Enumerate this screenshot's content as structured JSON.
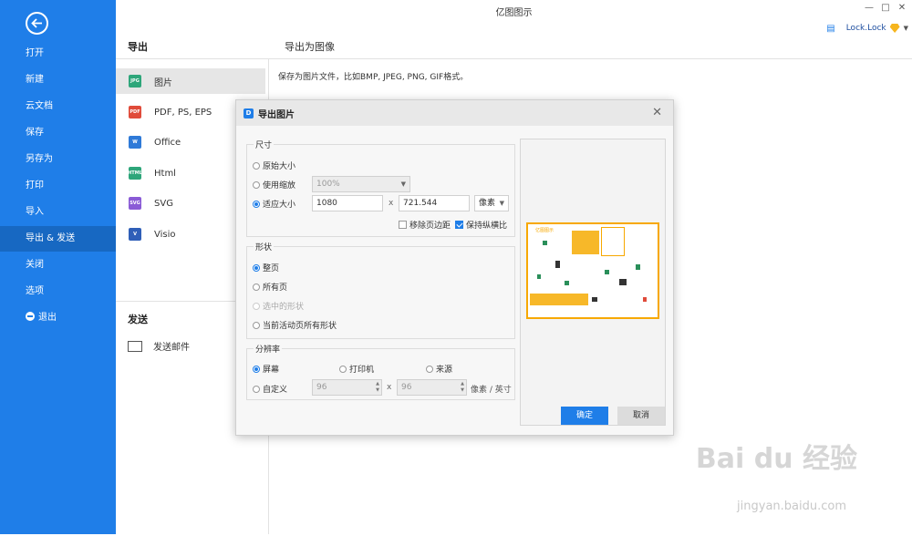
{
  "app": {
    "title": "亿图图示",
    "user": "Lock.Lock"
  },
  "sidebar": {
    "items": [
      {
        "label": "打开"
      },
      {
        "label": "新建"
      },
      {
        "label": "云文档"
      },
      {
        "label": "保存"
      },
      {
        "label": "另存为"
      },
      {
        "label": "打印"
      },
      {
        "label": "导入"
      },
      {
        "label": "导出 & 发送"
      },
      {
        "label": "关闭"
      },
      {
        "label": "选项"
      },
      {
        "label": "退出"
      }
    ],
    "active_index": 7
  },
  "export_panel": {
    "header": "导出",
    "formats": [
      {
        "label": "图片",
        "badge": "JPG",
        "color": "#2ea67a"
      },
      {
        "label": "PDF, PS, EPS",
        "badge": "PDF",
        "color": "#e04b3a"
      },
      {
        "label": "Office",
        "badge": "W",
        "color": "#2f7ad8"
      },
      {
        "label": "Html",
        "badge": "HTML",
        "color": "#2ea67a"
      },
      {
        "label": "SVG",
        "badge": "SVG",
        "color": "#8a5bd6"
      },
      {
        "label": "Visio",
        "badge": "V",
        "color": "#2f5fb8"
      }
    ],
    "send_header": "发送",
    "send_email": "发送邮件"
  },
  "image_panel": {
    "header": "导出为图像",
    "description": "保存为图片文件，比如BMP, JPEG, PNG, GIF格式。"
  },
  "dialog": {
    "title": "导出图片",
    "size_group": {
      "title": "尺寸",
      "original": "原始大小",
      "use_zoom": "使用缩放",
      "zoom_value": "100%",
      "fit_size": "适应大小",
      "width": "1080",
      "height": "721.544",
      "unit": "像素",
      "remove_margin": "移除页边距",
      "keep_ratio": "保持纵横比"
    },
    "shape_group": {
      "title": "形状",
      "whole_page": "整页",
      "all_pages": "所有页",
      "selected": "选中的形状",
      "current_page_all": "当前活动页所有形状"
    },
    "resolution_group": {
      "title": "分辨率",
      "screen": "屏幕",
      "printer": "打印机",
      "source": "来源",
      "custom": "自定义",
      "dpi_x": "96",
      "dpi_y": "96",
      "dpi_unit": "像素 / 英寸"
    },
    "ok": "确定",
    "cancel": "取消",
    "preview_title": "亿图图示"
  },
  "watermark": {
    "text": "Bai du 经验",
    "url": "jingyan.baidu.com"
  }
}
